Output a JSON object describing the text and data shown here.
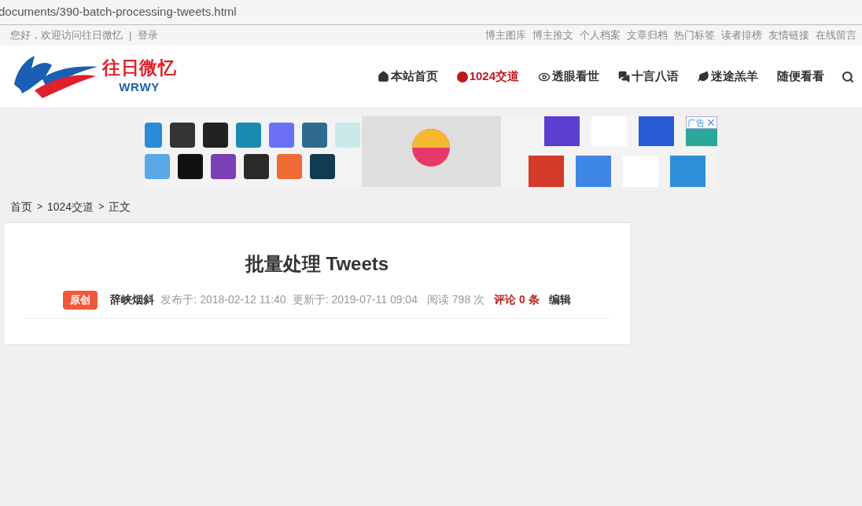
{
  "address_bar": {
    "url": "documents/390-batch-processing-tweets.html"
  },
  "top_bar": {
    "greeting": "您好，欢迎访问往日微忆",
    "separator": "|",
    "login": "登录",
    "links": [
      "博主图库",
      "博主推文",
      "个人档案",
      "文章归档",
      "热门标签",
      "读者排榜",
      "友情链接",
      "在线留言"
    ]
  },
  "header": {
    "logo_text": "往日微忆",
    "logo_subtext": "WRWY",
    "nav": [
      {
        "label": "本站首页",
        "kind": "home",
        "selected": false
      },
      {
        "label": "1024交道",
        "kind": "dot",
        "selected": true
      },
      {
        "label": "透眼看世",
        "kind": "eye",
        "selected": false
      },
      {
        "label": "十言八语",
        "kind": "comments",
        "selected": false
      },
      {
        "label": "迷途羔羊",
        "kind": "leaf",
        "selected": false
      },
      {
        "label": "随便看看",
        "kind": "plain",
        "selected": false
      }
    ]
  },
  "ad": {
    "label": "广告"
  },
  "breadcrumb": [
    {
      "kind": "link",
      "text": "首页"
    },
    {
      "kind": "separator",
      "text": ">"
    },
    {
      "kind": "link",
      "text": "1024交道"
    },
    {
      "kind": "separator",
      "text": ">"
    },
    {
      "kind": "current",
      "text": "正文"
    }
  ],
  "article": {
    "title": "批量处理 Tweets",
    "badge": "原创",
    "author": "辞峡烟斜",
    "published": "发布于: 2018-02-12 11:40",
    "updated": "更新于: 2019-07-11 09:04",
    "views": "阅读 798 次",
    "comments_label": "评论",
    "comments_count": "0",
    "comments_unit": "条",
    "edit": "编辑"
  }
}
